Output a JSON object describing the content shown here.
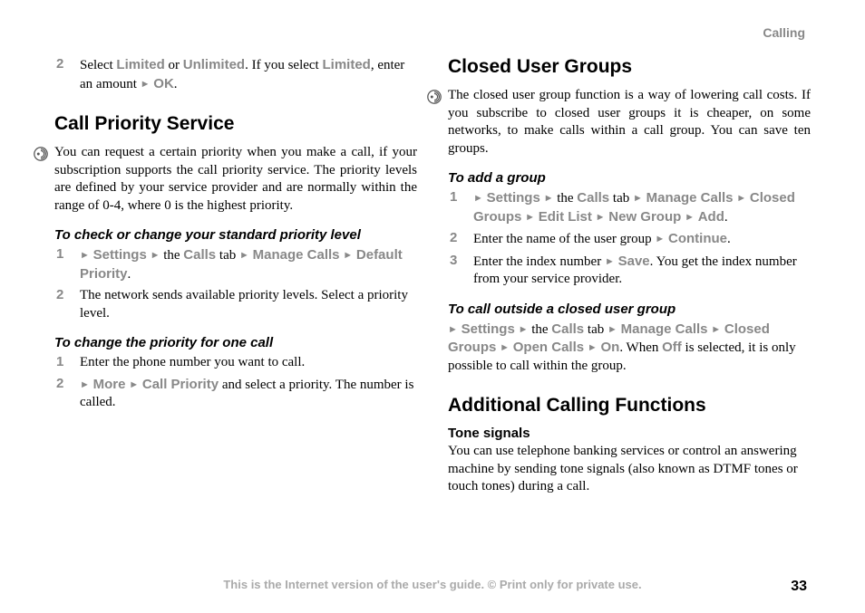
{
  "header": {
    "chapter": "Calling"
  },
  "left": {
    "step2_pre": "Select ",
    "step2_limited": "Limited",
    "step2_or": " or ",
    "step2_unlimited": "Unlimited",
    "step2_post1": ". If you select ",
    "step2_post2": ", enter an amount ",
    "step2_ok": "OK",
    "section1_title": "Call Priority Service",
    "section1_para": "You can request a certain priority when you make a call, if your subscription supports the call priority service. The priority levels are defined by your service provider and are normally within the range of 0-4, where 0 is the highest priority.",
    "sub1_title": "To check or change your standard priority level",
    "s1_step1_settings": "Settings",
    "s1_step1_the": " the ",
    "s1_step1_calls": "Calls",
    "s1_step1_tab": " tab ",
    "s1_step1_manage": "Manage Calls",
    "s1_step1_default": "Default Priority",
    "s1_step2": "The network sends available priority levels. Select a priority level.",
    "sub2_title": "To change the priority for one call",
    "s2_step1": "Enter the phone number you want to call.",
    "s2_step2_more": "More",
    "s2_step2_cp": "Call Priority",
    "s2_step2_post": " and select a priority. The number is called."
  },
  "right": {
    "section2_title": "Closed User Groups",
    "section2_para": "The closed user group function is a way of lowering call costs. If you subscribe to closed user groups it is cheaper, on some networks, to make calls within a call group. You can save ten groups.",
    "sub3_title": "To add a group",
    "s3_step1_settings": "Settings",
    "s3_step1_the": " the ",
    "s3_step1_calls": "Calls",
    "s3_step1_tab": " tab ",
    "s3_step1_manage": "Manage Calls",
    "s3_step1_closed": "Closed Groups",
    "s3_step1_edit": "Edit List",
    "s3_step1_new": "New Group",
    "s3_step1_add": "Add",
    "s3_step2_pre": "Enter the name of the user group ",
    "s3_step2_continue": "Continue",
    "s3_step3_pre": "Enter the index number ",
    "s3_step3_save": "Save",
    "s3_step3_post": ". You get the index number from your service provider.",
    "sub4_title": "To call outside a closed user group",
    "s4_settings": "Settings",
    "s4_the": " the ",
    "s4_calls": "Calls",
    "s4_tab": " tab ",
    "s4_manage": "Manage Calls",
    "s4_closed": "Closed Groups",
    "s4_open": "Open Calls",
    "s4_on": "On",
    "s4_post1": ". When ",
    "s4_off": "Off",
    "s4_post2": " is selected, it is only possible to call within the group.",
    "section3_title": "Additional Calling Functions",
    "mini_title": "Tone signals",
    "mini_para": "You can use telephone banking services or control an answering machine by sending tone signals (also known as DTMF tones or touch tones) during a call."
  },
  "footer": {
    "text": "This is the Internet version of the user's guide. © Print only for private use.",
    "page": "33"
  },
  "nums": {
    "n1": "1",
    "n2": "2",
    "n3": "3"
  }
}
